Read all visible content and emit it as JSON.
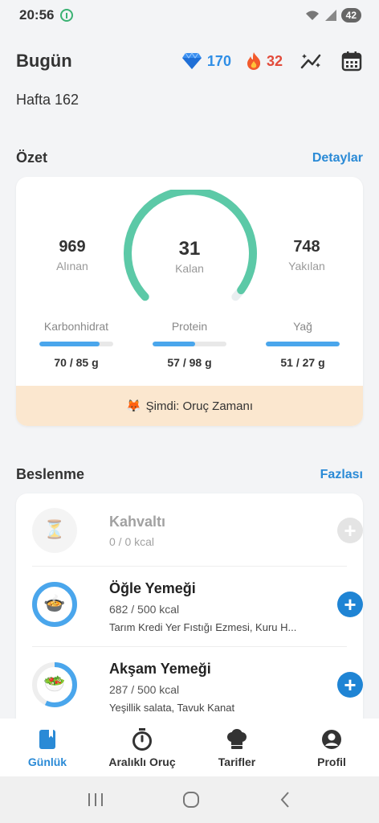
{
  "status": {
    "time": "20:56",
    "battery": "42"
  },
  "header": {
    "title": "Bugün",
    "gems": "170",
    "streak": "32"
  },
  "week": "Hafta 162",
  "summary": {
    "title": "Özet",
    "link": "Detaylar",
    "eaten": {
      "value": "969",
      "label": "Alınan"
    },
    "remaining": {
      "value": "31",
      "label": "Kalan"
    },
    "burned": {
      "value": "748",
      "label": "Yakılan"
    },
    "ring_progress": 0.97,
    "macros": [
      {
        "label": "Karbonhidrat",
        "value": "70 / 85 g",
        "progress": 0.82
      },
      {
        "label": "Protein",
        "value": "57 / 98 g",
        "progress": 0.58
      },
      {
        "label": "Yağ",
        "value": "51 / 27 g",
        "progress": 1.0
      }
    ],
    "fasting": {
      "emoji": "🦊",
      "text": "Şimdi: Oruç Zamanı"
    }
  },
  "nutrition": {
    "title": "Beslenme",
    "link": "Fazlası",
    "meals": [
      {
        "name": "Kahvaltı",
        "kcal": "0 / 0 kcal",
        "foods": "",
        "emoji": "⏳",
        "progress": 0,
        "active": false
      },
      {
        "name": "Öğle Yemeği",
        "kcal": "682 / 500 kcal",
        "foods": "Tarım Kredi Yer Fıstığı Ezmesi, Kuru H...",
        "emoji": "🍲",
        "progress": 1.0,
        "active": true
      },
      {
        "name": "Akşam Yemeği",
        "kcal": "287 / 500 kcal",
        "foods": "Yeşillik salata, Tavuk Kanat",
        "emoji": "🥗",
        "progress": 0.57,
        "active": true
      }
    ]
  },
  "nav": [
    {
      "label": "Günlük",
      "icon": "diary-icon",
      "active": true
    },
    {
      "label": "Aralıklı Oruç",
      "icon": "stopwatch-icon",
      "active": false
    },
    {
      "label": "Tarifler",
      "icon": "chef-hat-icon",
      "active": false
    },
    {
      "label": "Profil",
      "icon": "profile-icon",
      "active": false
    }
  ],
  "colors": {
    "accent": "#2a8ad6",
    "ring": "#5cc9a7",
    "bar": "#4aa6ec",
    "banner": "#fbe7cf",
    "fab": "#1f84d4"
  }
}
